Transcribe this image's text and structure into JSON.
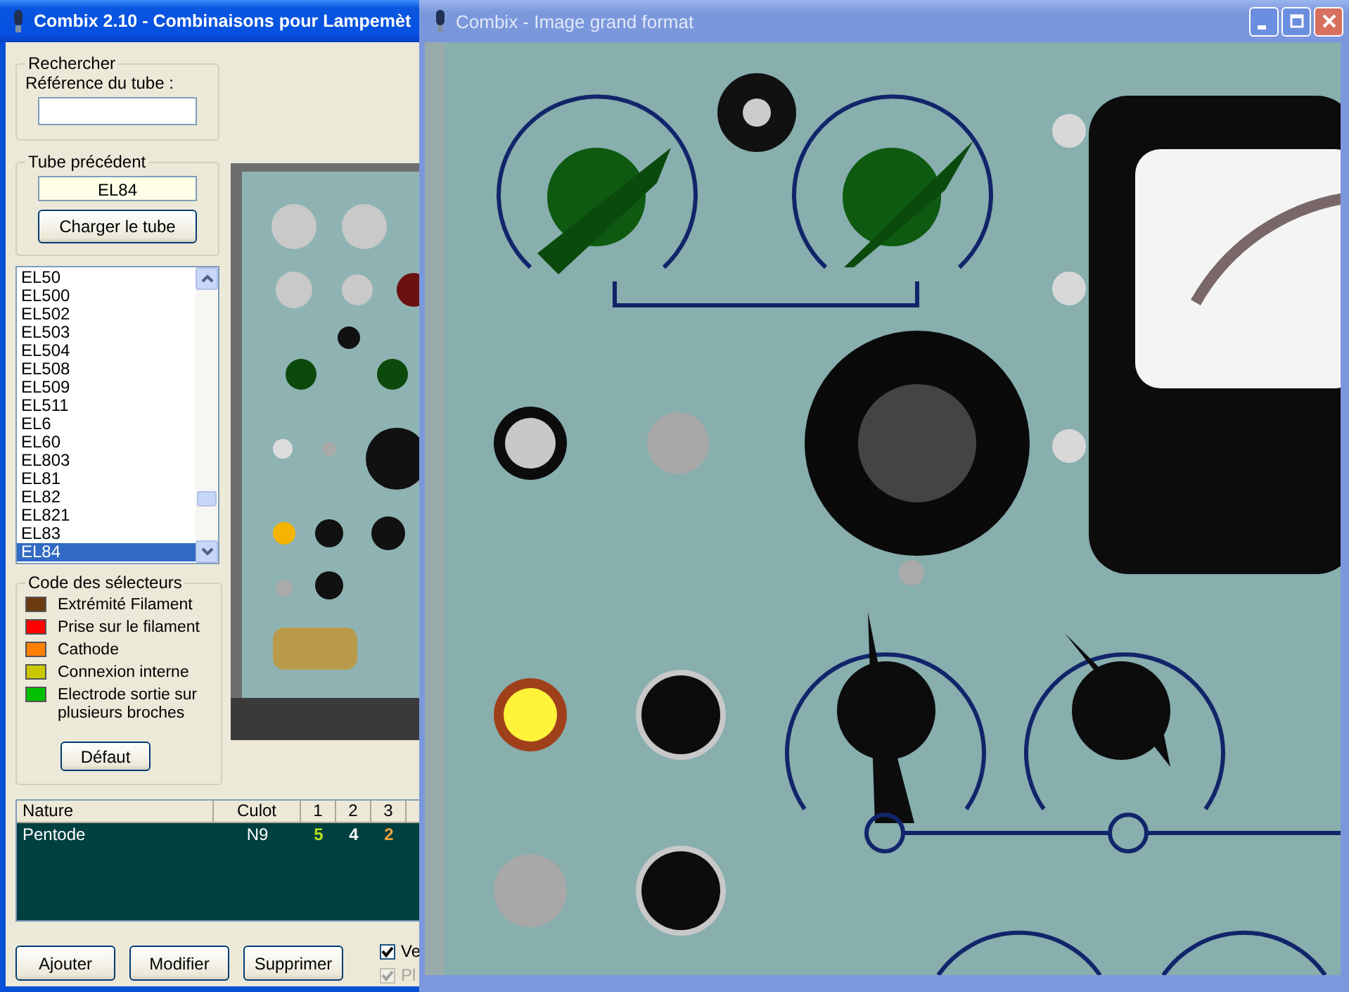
{
  "main_window": {
    "title": "Combix 2.10 - Combinaisons pour Lampemèt"
  },
  "search": {
    "legend": "Rechercher",
    "label": "Référence du tube :"
  },
  "previous_tube": {
    "legend": "Tube précédent",
    "value": "EL84",
    "button": "Charger le tube"
  },
  "tube_list": {
    "items": [
      {
        "label": "EL50",
        "selected": false
      },
      {
        "label": "EL500",
        "selected": false
      },
      {
        "label": "EL502",
        "selected": false
      },
      {
        "label": "EL503",
        "selected": false
      },
      {
        "label": "EL504",
        "selected": false
      },
      {
        "label": "EL508",
        "selected": false
      },
      {
        "label": "EL509",
        "selected": false
      },
      {
        "label": "EL511",
        "selected": false
      },
      {
        "label": "EL6",
        "selected": false
      },
      {
        "label": "EL60",
        "selected": false
      },
      {
        "label": "EL803",
        "selected": false
      },
      {
        "label": "EL81",
        "selected": false
      },
      {
        "label": "EL82",
        "selected": false
      },
      {
        "label": "EL821",
        "selected": false
      },
      {
        "label": "EL83",
        "selected": false
      },
      {
        "label": "EL84",
        "selected": true
      }
    ]
  },
  "selector_code": {
    "legend": "Code des sélecteurs",
    "items": [
      {
        "label": "Extrémité Filament",
        "color": "#6b3a10"
      },
      {
        "label": "Prise sur le filament",
        "color": "#ff0000"
      },
      {
        "label": "Cathode",
        "color": "#ff8000"
      },
      {
        "label": "Connexion interne",
        "color": "#c8c800"
      },
      {
        "label": "Electrode sortie sur plusieurs broches",
        "color": "#00c000"
      }
    ],
    "button": "Défaut"
  },
  "table": {
    "columns": [
      "Nature",
      "Culot",
      "1",
      "2",
      "3"
    ],
    "rows": [
      {
        "cells": [
          {
            "text": "Pentode"
          },
          {
            "text": "N9"
          },
          {
            "text": "5",
            "color": "#b0e020"
          },
          {
            "text": "4",
            "color": "#ffffff"
          },
          {
            "text": "2",
            "color": "#f0a040"
          }
        ]
      }
    ]
  },
  "actions": [
    "Ajouter",
    "Modifier",
    "Supprimer"
  ],
  "checkboxes": [
    {
      "label": "Ve",
      "checked": true,
      "disabled": false
    },
    {
      "label": "Pl",
      "checked": true,
      "disabled": true
    }
  ],
  "image_window": {
    "title": "Combix - Image grand format"
  }
}
